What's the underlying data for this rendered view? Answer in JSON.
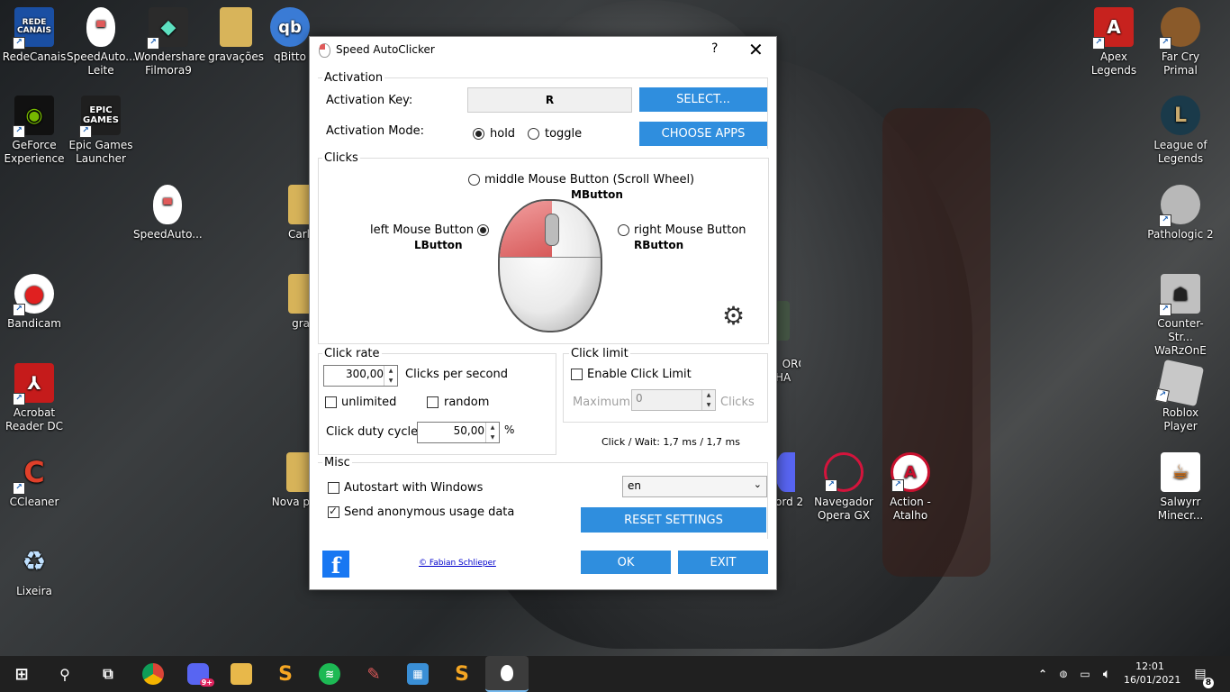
{
  "desktop": {
    "icons_left": [
      {
        "label": "RedeCanais",
        "pic": "REDE\nCANAIS",
        "color": "#1a4fa3"
      },
      {
        "label": "GeForce Experience",
        "pic": "",
        "color": "#111111"
      },
      {
        "label": "Bandicam",
        "pic": "",
        "color": "#111111"
      },
      {
        "label": "Acrobat Reader DC",
        "pic": "",
        "color": "#c51b1b"
      },
      {
        "label": "CCleaner",
        "pic": "",
        "color": "#d33a2a"
      },
      {
        "label": "Lixeira",
        "pic": "",
        "color": "#3f7fbf"
      }
    ],
    "icons_col2": [
      {
        "label": "SpeedAuto... Leite",
        "color": "#ffffff"
      },
      {
        "label": "Epic Games Launcher",
        "pic": "EPIC\nGAMES",
        "color": "#1f1f1f"
      },
      {
        "label": "SpeedAuto...",
        "color": "#ffffff"
      }
    ],
    "icons_top": [
      {
        "label": "Wondershare Filmora9",
        "color": "#2b2b2b"
      },
      {
        "label": "gravações",
        "color": "#d8b45a"
      },
      {
        "label": "qBitto",
        "pic": "qb",
        "color": "#3a7bd5"
      }
    ],
    "icons_mid": [
      {
        "label": "Carl",
        "color": "#d8b45a"
      },
      {
        "label": "gra",
        "color": "#d8b45a"
      },
      {
        "label": "Nova p",
        "color": "#d8b45a"
      }
    ],
    "icons_right_partial": [
      {
        "label": "ORO\nHA",
        "color": "#445544"
      },
      {
        "label": "ord 2",
        "color": "#5865f2"
      }
    ],
    "icons_bottom_row": [
      {
        "label": "Navegador Opera GX",
        "color": "#d4143c"
      },
      {
        "label": "Action - Atalho",
        "color": "#c8102e"
      }
    ],
    "icons_right": [
      {
        "label": "Apex Legends",
        "color": "#c7221e"
      },
      {
        "label": "Far Cry Primal",
        "color": "#8a5a2a"
      },
      {
        "label": "League of Legends",
        "color": "#1a3a4a"
      },
      {
        "label": "Pathologic 2",
        "color": "#b8b8b8"
      },
      {
        "label": "Counter-Str... WaRzOnE",
        "color": "#c0c0c0"
      },
      {
        "label": "Roblox Player",
        "color": "#c8c8c8"
      },
      {
        "label": "Salwyrr Minecr...",
        "color": "#ffffff"
      }
    ]
  },
  "dialog": {
    "title": "Speed AutoClicker",
    "help": "?",
    "close": "✕",
    "activation": {
      "group": "Activation",
      "key_label": "Activation Key:",
      "key_value": "R",
      "select_btn": "SELECT...",
      "mode_label": "Activation Mode:",
      "mode_hold": "hold",
      "mode_toggle": "toggle",
      "choose_btn": "CHOOSE APPS"
    },
    "clicks": {
      "group": "Clicks",
      "middle_label": "middle Mouse Button (Scroll Wheel)",
      "middle_code": "MButton",
      "left_label": "left Mouse Button",
      "left_code": "LButton",
      "right_label": "right Mouse Button",
      "right_code": "RButton"
    },
    "rate": {
      "group": "Click rate",
      "value": "300,00",
      "unit": "Clicks per second",
      "unlimited": "unlimited",
      "random": "random",
      "duty_label": "Click duty cycle:",
      "duty_value": "50,00",
      "duty_unit": "%"
    },
    "limit": {
      "group": "Click limit",
      "enable": "Enable Click Limit",
      "max_label": "Maximum",
      "max_value": "0",
      "max_unit": "Clicks",
      "wait_info": "Click / Wait: 1,7 ms / 1,7 ms"
    },
    "misc": {
      "group": "Misc",
      "autostart": "Autostart with Windows",
      "anon": "Send anonymous usage data",
      "lang": "en",
      "reset_btn": "RESET SETTINGS"
    },
    "footer": {
      "copyright": "© Fabian Schlieper",
      "ok": "OK",
      "exit": "EXIT"
    }
  },
  "taskbar": {
    "time": "12:01",
    "date": "16/01/2021",
    "notif_count": "8",
    "badge": "9+"
  }
}
